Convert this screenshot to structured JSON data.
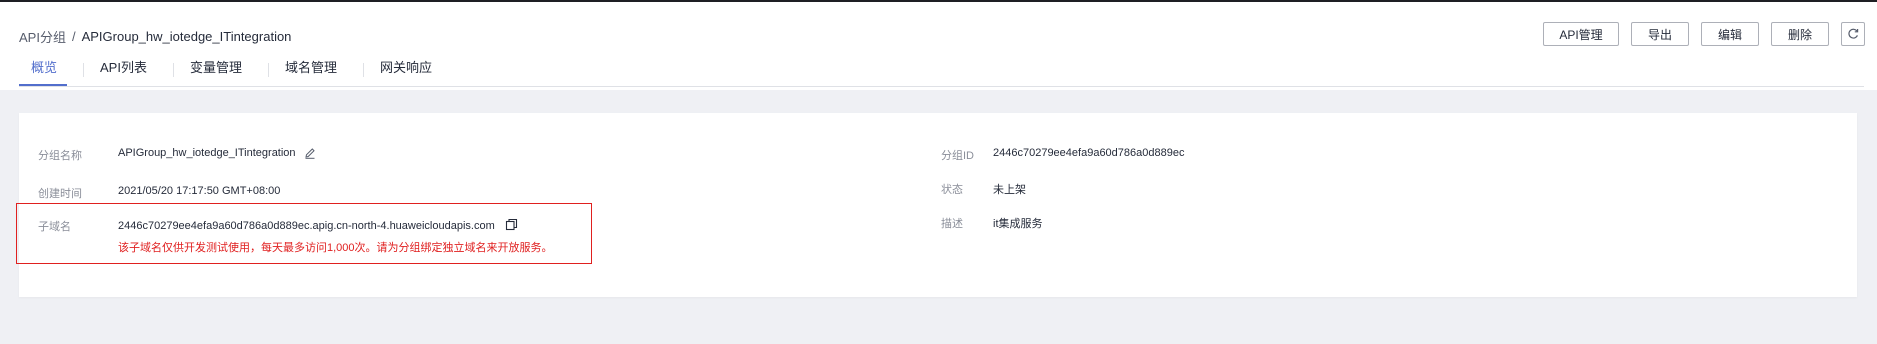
{
  "breadcrumb": {
    "parent": "API分组",
    "separator": "/",
    "current": "APIGroup_hw_iotedge_ITintegration"
  },
  "tabs": [
    {
      "label": "概览",
      "active": true
    },
    {
      "label": "API列表"
    },
    {
      "label": "变量管理"
    },
    {
      "label": "域名管理"
    },
    {
      "label": "网关响应"
    }
  ],
  "actions": {
    "api_manage": "API管理",
    "export": "导出",
    "edit": "编辑",
    "delete": "删除",
    "refresh_icon": "refresh-icon"
  },
  "overview": {
    "left": {
      "group_name_label": "分组名称",
      "group_name_value": "APIGroup_hw_iotedge_ITintegration",
      "created_label": "创建时间",
      "created_value": "2021/05/20 17:17:50 GMT+08:00",
      "subdomain_label": "子域名",
      "subdomain_value": "2446c70279ee4efa9a60d786a0d889ec.apig.cn-north-4.huaweicloudapis.com",
      "subdomain_warning": "该子域名仅供开发测试使用，每天最多访问1,000次。请为分组绑定独立域名来开放服务。"
    },
    "right": {
      "group_id_label": "分组ID",
      "group_id_value": "2446c70279ee4efa9a60d786a0d889ec",
      "status_label": "状态",
      "status_value": "未上架",
      "desc_label": "描述",
      "desc_value": "it集成服务"
    }
  },
  "colors": {
    "accent": "#526ecc",
    "warning": "#e02020",
    "background": "#eff0f4"
  }
}
